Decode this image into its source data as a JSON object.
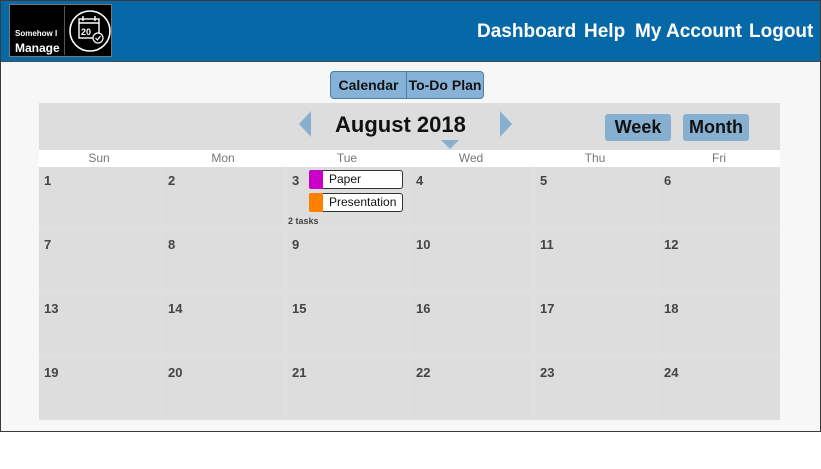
{
  "header": {
    "logo_line1": "Somehow I",
    "logo_line2": "Manage",
    "logo_icon_number": "20",
    "nav": [
      "Dashboard",
      "Help",
      "My Account",
      "Logout"
    ]
  },
  "tabs": [
    "Calendar",
    "To-Do Plan"
  ],
  "calendar": {
    "title": "August 2018",
    "week_label": "Week",
    "month_label": "Month",
    "weekdays": [
      "Sun",
      "Mon",
      "Tue",
      "Wed",
      "Thu",
      "Fri"
    ],
    "weeks": [
      [
        "1",
        "2",
        "3",
        "4",
        "5",
        "6"
      ],
      [
        "7",
        "8",
        "9",
        "10",
        "11",
        "12"
      ],
      [
        "13",
        "14",
        "15",
        "16",
        "17",
        "18"
      ],
      [
        "19",
        "20",
        "21",
        "22",
        "23",
        "24"
      ]
    ],
    "tasks_day": "3",
    "tasks": [
      {
        "label": "Paper",
        "color": "#c800c8"
      },
      {
        "label": "Presentation",
        "color": "#ff8000"
      }
    ],
    "task_count": "2 tasks"
  },
  "colors": {
    "header": "#0768a8",
    "accent": "#86afd0"
  }
}
